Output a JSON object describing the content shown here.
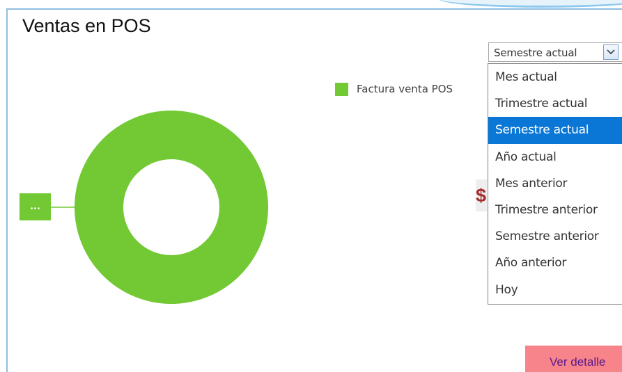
{
  "panel": {
    "title": "Ventas en POS"
  },
  "legend": {
    "items": [
      {
        "label": "Factura venta POS",
        "color": "#72c933"
      }
    ]
  },
  "period_select": {
    "value": "Semestre actual",
    "options": [
      "Mes actual",
      "Trimestre actual",
      "Semestre actual",
      "Año actual",
      "Mes anterior",
      "Trimestre anterior",
      "Semestre anterior",
      "Año anterior",
      "Hoy"
    ],
    "selected_index": 2
  },
  "total_label": {
    "currency_symbol": "$"
  },
  "actions": {
    "detail_label": "Ver detalle"
  },
  "chart_data": {
    "type": "pie",
    "variant": "donut",
    "categories": [
      "Factura venta POS"
    ],
    "values": [
      100
    ],
    "colors": [
      "#72c933"
    ],
    "data_labels": [
      "..."
    ],
    "legend_position": "top-right"
  }
}
